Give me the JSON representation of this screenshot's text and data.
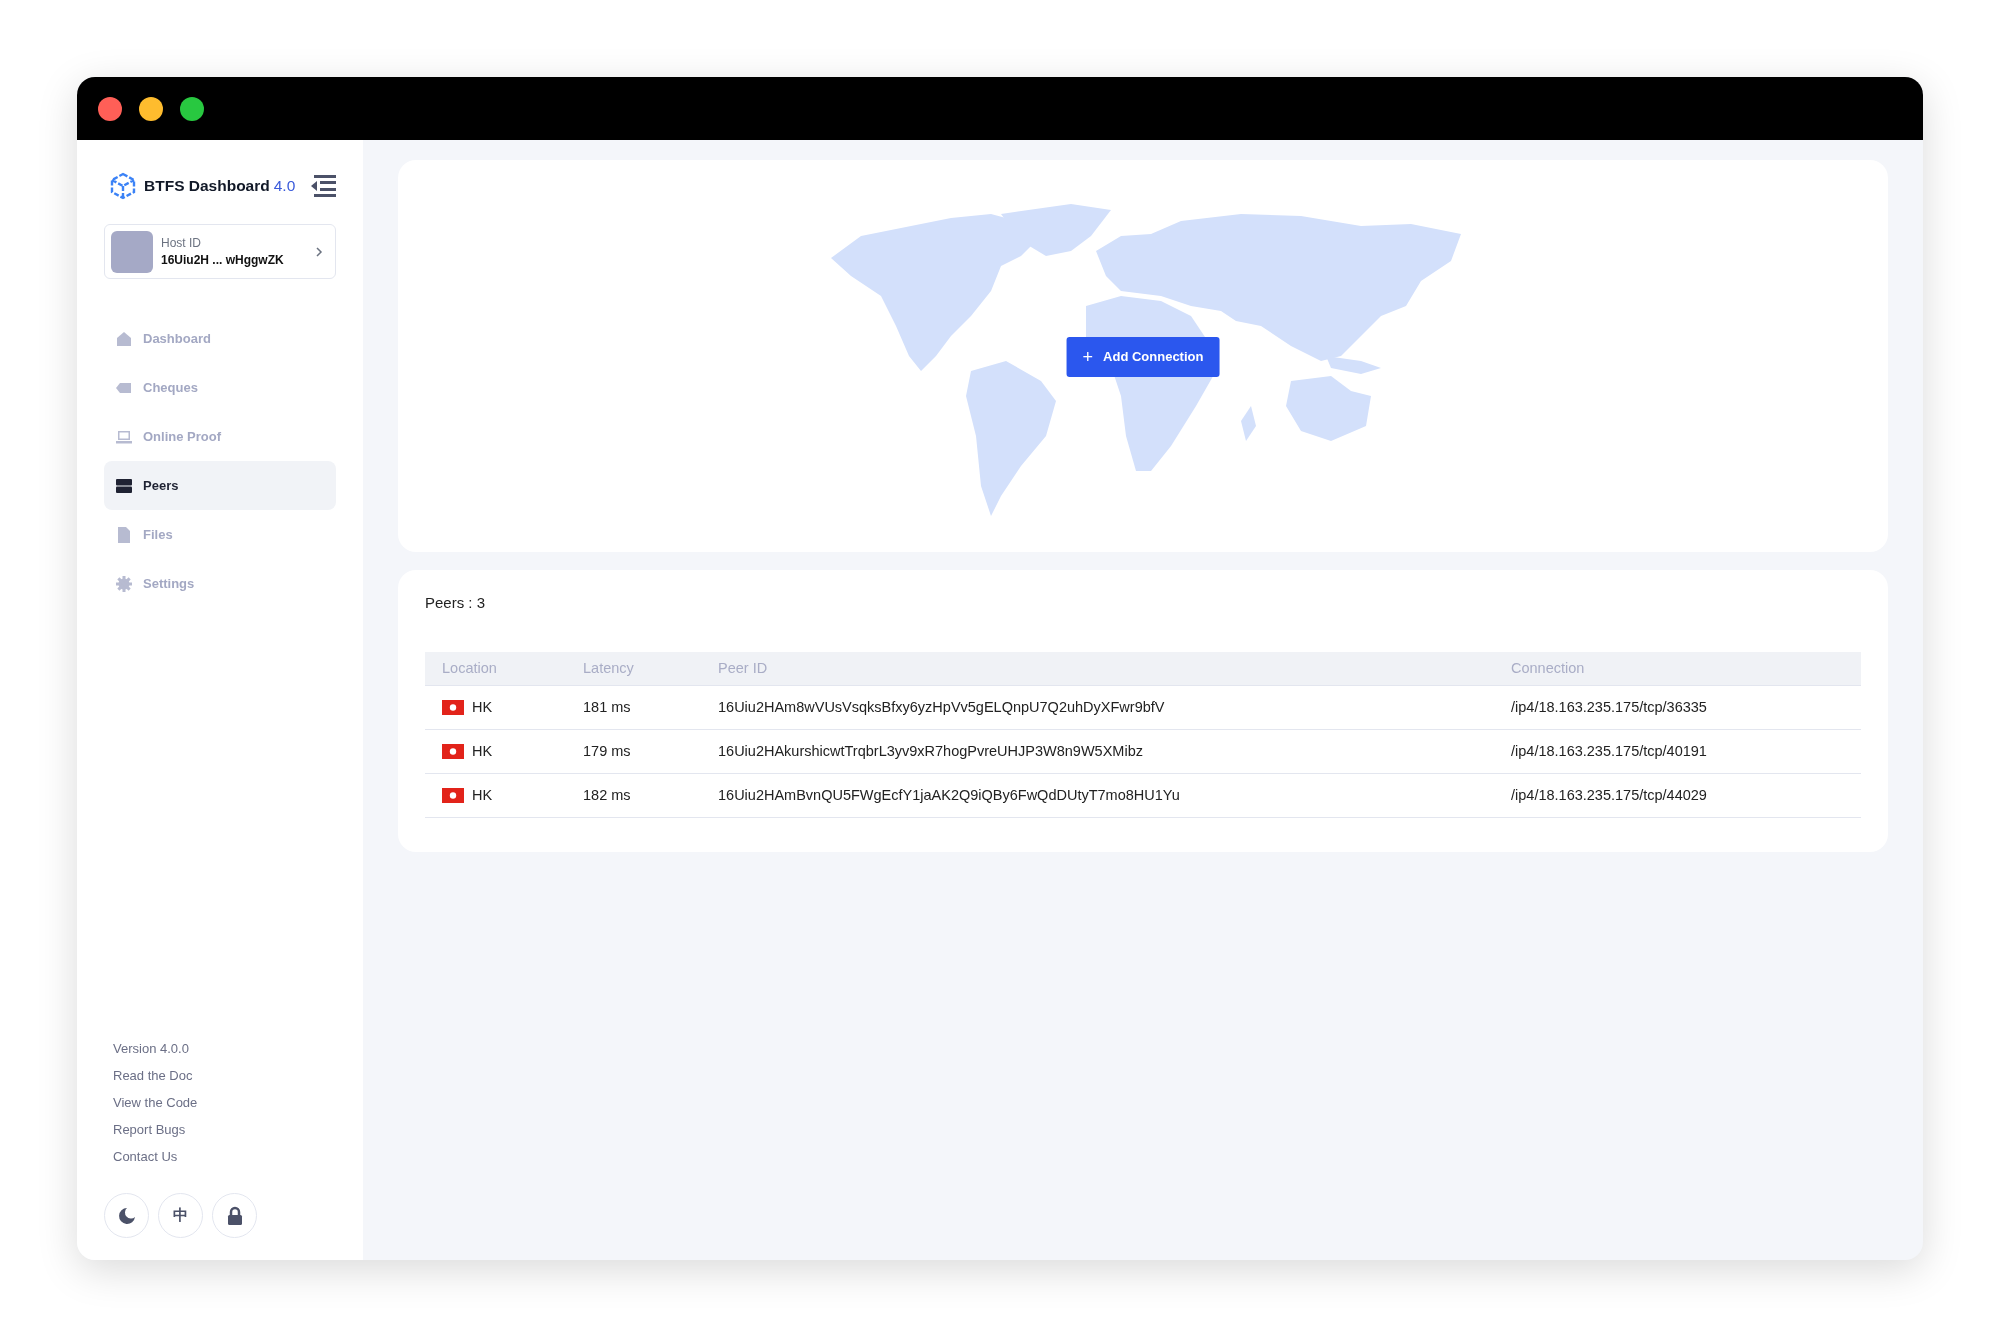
{
  "app": {
    "title": "BTFS Dashboard",
    "version_badge": "4.0"
  },
  "host": {
    "label": "Host ID",
    "value": "16Uiu2H ... wHggwZK"
  },
  "nav": [
    {
      "label": "Dashboard",
      "kind": "home",
      "selected": false
    },
    {
      "label": "Cheques",
      "kind": "tag",
      "selected": false
    },
    {
      "label": "Online Proof",
      "kind": "laptop",
      "selected": false
    },
    {
      "label": "Peers",
      "kind": "server",
      "selected": true
    },
    {
      "label": "Files",
      "kind": "file",
      "selected": false
    },
    {
      "label": "Settings",
      "kind": "gear",
      "selected": false
    }
  ],
  "footer_links": [
    "Version 4.0.0",
    "Read the Doc",
    "View the Code",
    "Report Bugs",
    "Contact Us"
  ],
  "footer_buttons": [
    {
      "kind": "moon"
    },
    {
      "kind": "text",
      "label": "中"
    },
    {
      "kind": "lock"
    }
  ],
  "map": {
    "button": {
      "icon": "+",
      "label": "Add Connection"
    }
  },
  "peers": {
    "title": "Peers : 3",
    "columns": [
      "Location",
      "Latency",
      "Peer ID",
      "Connection"
    ],
    "rows": [
      {
        "location": "HK",
        "latency": "181 ms",
        "peer_id": "16Uiu2HAm8wVUsVsqksBfxy6yzHpVv5gELQnpU7Q2uhDyXFwr9bfV",
        "connection": "/ip4/18.163.235.175/tcp/36335"
      },
      {
        "location": "HK",
        "latency": "179 ms",
        "peer_id": "16Uiu2HAkurshicwtTrqbrL3yv9xR7hogPvreUHJP3W8n9W5XMibz",
        "connection": "/ip4/18.163.235.175/tcp/40191"
      },
      {
        "location": "HK",
        "latency": "182 ms",
        "peer_id": "16Uiu2HAmBvnQU5FWgEcfY1jaAK2Q9iQBy6FwQdDUtyT7mo8HU1Yu",
        "connection": "/ip4/18.163.235.175/tcp/44029"
      }
    ]
  }
}
